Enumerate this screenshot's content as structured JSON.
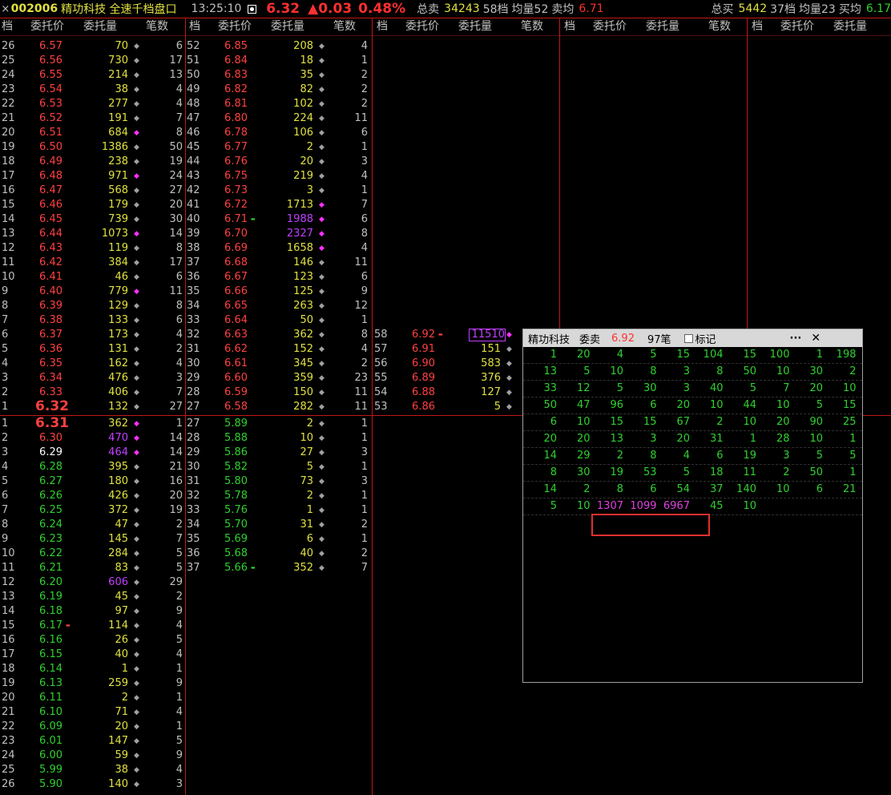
{
  "topbar": {
    "close_glyph": "×",
    "code": "002006",
    "name": "精功科技 全速千档盘口",
    "time": "13:25:10",
    "price": "6.32",
    "change": "▲0.03",
    "percent": "0.48%",
    "sell_total_label": "总卖",
    "sell_total": "34243",
    "sell_levels": "58档",
    "sell_avg_vol_label": "均量52",
    "sell_avg_price_label": "卖均",
    "sell_avg_price": "6.71",
    "buy_total_label": "总买",
    "buy_total": "5442",
    "buy_levels": "37档",
    "buy_avg_vol_label": "均量23",
    "buy_avg_price_label": "买均",
    "buy_avg_price": "6.17",
    "ratio_bar": {
      "sell_fraction": 0.87,
      "buy_fraction": 0.13,
      "sell_color": "#3a90e0",
      "buy_color": "#e0a030"
    }
  },
  "headers": {
    "level": "档",
    "price": "委托价",
    "volume": "委托量",
    "count": "笔数"
  },
  "ask_col1": [
    {
      "lvl": "26",
      "px": "6.57",
      "vol": "70",
      "cnt": "6",
      "vc": "yellow"
    },
    {
      "lvl": "25",
      "px": "6.56",
      "vol": "730",
      "cnt": "17",
      "vc": "yellow"
    },
    {
      "lvl": "24",
      "px": "6.55",
      "vol": "214",
      "cnt": "13",
      "vc": "yellow"
    },
    {
      "lvl": "23",
      "px": "6.54",
      "vol": "38",
      "cnt": "4",
      "vc": "yellow"
    },
    {
      "lvl": "22",
      "px": "6.53",
      "vol": "277",
      "cnt": "4",
      "vc": "yellow"
    },
    {
      "lvl": "21",
      "px": "6.52",
      "vol": "191",
      "cnt": "7",
      "vc": "yellow"
    },
    {
      "lvl": "20",
      "px": "6.51",
      "vol": "684",
      "cnt": "8",
      "vc": "yellow",
      "dot": "magenta"
    },
    {
      "lvl": "19",
      "px": "6.50",
      "vol": "1386",
      "cnt": "50",
      "vc": "yellow"
    },
    {
      "lvl": "18",
      "px": "6.49",
      "vol": "238",
      "cnt": "19",
      "vc": "yellow"
    },
    {
      "lvl": "17",
      "px": "6.48",
      "vol": "971",
      "cnt": "24",
      "vc": "yellow",
      "dot": "magenta"
    },
    {
      "lvl": "16",
      "px": "6.47",
      "vol": "568",
      "cnt": "27",
      "vc": "yellow"
    },
    {
      "lvl": "15",
      "px": "6.46",
      "vol": "179",
      "cnt": "20",
      "vc": "yellow"
    },
    {
      "lvl": "14",
      "px": "6.45",
      "vol": "739",
      "cnt": "30",
      "vc": "yellow"
    },
    {
      "lvl": "13",
      "px": "6.44",
      "vol": "1073",
      "cnt": "14",
      "vc": "yellow",
      "dot": "magenta"
    },
    {
      "lvl": "12",
      "px": "6.43",
      "vol": "119",
      "cnt": "8",
      "vc": "yellow"
    },
    {
      "lvl": "11",
      "px": "6.42",
      "vol": "384",
      "cnt": "17",
      "vc": "yellow"
    },
    {
      "lvl": "10",
      "px": "6.41",
      "vol": "46",
      "cnt": "6",
      "vc": "yellow"
    },
    {
      "lvl": "9",
      "px": "6.40",
      "vol": "779",
      "cnt": "11",
      "vc": "yellow",
      "dot": "magenta"
    },
    {
      "lvl": "8",
      "px": "6.39",
      "vol": "129",
      "cnt": "8",
      "vc": "yellow"
    },
    {
      "lvl": "7",
      "px": "6.38",
      "vol": "133",
      "cnt": "6",
      "vc": "yellow"
    },
    {
      "lvl": "6",
      "px": "6.37",
      "vol": "173",
      "cnt": "4",
      "vc": "yellow"
    },
    {
      "lvl": "5",
      "px": "6.36",
      "vol": "131",
      "cnt": "2",
      "vc": "yellow"
    },
    {
      "lvl": "4",
      "px": "6.35",
      "vol": "162",
      "cnt": "4",
      "vc": "yellow"
    },
    {
      "lvl": "3",
      "px": "6.34",
      "vol": "476",
      "cnt": "3",
      "vc": "yellow"
    },
    {
      "lvl": "2",
      "px": "6.33",
      "vol": "406",
      "cnt": "7",
      "vc": "yellow"
    },
    {
      "lvl": "1",
      "px": "6.32",
      "vol": "132",
      "cnt": "27",
      "vc": "yellow",
      "big": true
    }
  ],
  "ask_col2": [
    {
      "lvl": "52",
      "px": "6.85",
      "vol": "208",
      "cnt": "4",
      "vc": "yellow"
    },
    {
      "lvl": "51",
      "px": "6.84",
      "vol": "18",
      "cnt": "1",
      "vc": "yellow"
    },
    {
      "lvl": "50",
      "px": "6.83",
      "vol": "35",
      "cnt": "2",
      "vc": "yellow"
    },
    {
      "lvl": "49",
      "px": "6.82",
      "vol": "82",
      "cnt": "2",
      "vc": "yellow"
    },
    {
      "lvl": "48",
      "px": "6.81",
      "vol": "102",
      "cnt": "2",
      "vc": "yellow"
    },
    {
      "lvl": "47",
      "px": "6.80",
      "vol": "224",
      "cnt": "11",
      "vc": "yellow"
    },
    {
      "lvl": "46",
      "px": "6.78",
      "vol": "106",
      "cnt": "6",
      "vc": "yellow"
    },
    {
      "lvl": "45",
      "px": "6.77",
      "vol": "2",
      "cnt": "1",
      "vc": "yellow"
    },
    {
      "lvl": "44",
      "px": "6.76",
      "vol": "20",
      "cnt": "3",
      "vc": "yellow"
    },
    {
      "lvl": "43",
      "px": "6.75",
      "vol": "219",
      "cnt": "4",
      "vc": "yellow"
    },
    {
      "lvl": "42",
      "px": "6.73",
      "vol": "3",
      "cnt": "1",
      "vc": "yellow"
    },
    {
      "lvl": "41",
      "px": "6.72",
      "vol": "1713",
      "cnt": "7",
      "vc": "yellow",
      "dot": "magenta"
    },
    {
      "lvl": "40",
      "px": "6.71",
      "vol": "1988",
      "cnt": "6",
      "vc": "purple",
      "dot": "magenta",
      "mark": "green"
    },
    {
      "lvl": "39",
      "px": "6.70",
      "vol": "2327",
      "cnt": "8",
      "vc": "purple",
      "dot": "magenta"
    },
    {
      "lvl": "38",
      "px": "6.69",
      "vol": "1658",
      "cnt": "4",
      "vc": "yellow",
      "dot": "magenta"
    },
    {
      "lvl": "37",
      "px": "6.68",
      "vol": "146",
      "cnt": "11",
      "vc": "yellow"
    },
    {
      "lvl": "36",
      "px": "6.67",
      "vol": "123",
      "cnt": "6",
      "vc": "yellow"
    },
    {
      "lvl": "35",
      "px": "6.66",
      "vol": "125",
      "cnt": "9",
      "vc": "yellow"
    },
    {
      "lvl": "34",
      "px": "6.65",
      "vol": "263",
      "cnt": "12",
      "vc": "yellow"
    },
    {
      "lvl": "33",
      "px": "6.64",
      "vol": "50",
      "cnt": "1",
      "vc": "yellow"
    },
    {
      "lvl": "32",
      "px": "6.63",
      "vol": "362",
      "cnt": "8",
      "vc": "yellow"
    },
    {
      "lvl": "31",
      "px": "6.62",
      "vol": "152",
      "cnt": "4",
      "vc": "yellow"
    },
    {
      "lvl": "30",
      "px": "6.61",
      "vol": "345",
      "cnt": "2",
      "vc": "yellow"
    },
    {
      "lvl": "29",
      "px": "6.60",
      "vol": "359",
      "cnt": "23",
      "vc": "yellow"
    },
    {
      "lvl": "28",
      "px": "6.59",
      "vol": "150",
      "cnt": "11",
      "vc": "yellow"
    },
    {
      "lvl": "27",
      "px": "6.58",
      "vol": "282",
      "cnt": "11",
      "vc": "yellow"
    }
  ],
  "ask_col3": [
    {
      "lvl": "58",
      "px": "6.92",
      "vol": "11510",
      "cnt": "",
      "vc": "purple",
      "dot": "magenta",
      "mark": "red",
      "boxed": true
    },
    {
      "lvl": "57",
      "px": "6.91",
      "vol": "151",
      "cnt": "",
      "vc": "yellow"
    },
    {
      "lvl": "56",
      "px": "6.90",
      "vol": "583",
      "cnt": "",
      "vc": "yellow"
    },
    {
      "lvl": "55",
      "px": "6.89",
      "vol": "376",
      "cnt": "",
      "vc": "yellow"
    },
    {
      "lvl": "54",
      "px": "6.88",
      "vol": "127",
      "cnt": "",
      "vc": "yellow"
    },
    {
      "lvl": "53",
      "px": "6.86",
      "vol": "5",
      "cnt": "",
      "vc": "yellow"
    }
  ],
  "bid_col1": [
    {
      "lvl": "1",
      "px": "6.31",
      "vol": "362",
      "cnt": "1",
      "pc": "red",
      "vc": "yellow",
      "dot": "magenta",
      "big": true
    },
    {
      "lvl": "2",
      "px": "6.30",
      "vol": "470",
      "cnt": "14",
      "pc": "red",
      "vc": "purple",
      "dot": "magenta"
    },
    {
      "lvl": "3",
      "px": "6.29",
      "vol": "464",
      "cnt": "14",
      "pc": "white",
      "vc": "purple",
      "dot": "magenta"
    },
    {
      "lvl": "4",
      "px": "6.28",
      "vol": "395",
      "cnt": "21",
      "pc": "green",
      "vc": "yellow"
    },
    {
      "lvl": "5",
      "px": "6.27",
      "vol": "180",
      "cnt": "16",
      "pc": "green",
      "vc": "yellow"
    },
    {
      "lvl": "6",
      "px": "6.26",
      "vol": "426",
      "cnt": "20",
      "pc": "green",
      "vc": "yellow"
    },
    {
      "lvl": "7",
      "px": "6.25",
      "vol": "372",
      "cnt": "19",
      "pc": "green",
      "vc": "yellow"
    },
    {
      "lvl": "8",
      "px": "6.24",
      "vol": "47",
      "cnt": "2",
      "pc": "green",
      "vc": "yellow"
    },
    {
      "lvl": "9",
      "px": "6.23",
      "vol": "145",
      "cnt": "7",
      "pc": "green",
      "vc": "yellow"
    },
    {
      "lvl": "10",
      "px": "6.22",
      "vol": "284",
      "cnt": "5",
      "pc": "green",
      "vc": "yellow"
    },
    {
      "lvl": "11",
      "px": "6.21",
      "vol": "83",
      "cnt": "5",
      "pc": "green",
      "vc": "yellow"
    },
    {
      "lvl": "12",
      "px": "6.20",
      "vol": "606",
      "cnt": "29",
      "pc": "green",
      "vc": "purple"
    },
    {
      "lvl": "13",
      "px": "6.19",
      "vol": "45",
      "cnt": "2",
      "pc": "green",
      "vc": "yellow"
    },
    {
      "lvl": "14",
      "px": "6.18",
      "vol": "97",
      "cnt": "9",
      "pc": "green",
      "vc": "yellow"
    },
    {
      "lvl": "15",
      "px": "6.17",
      "vol": "114",
      "cnt": "4",
      "pc": "green",
      "vc": "yellow",
      "mark": "red"
    },
    {
      "lvl": "16",
      "px": "6.16",
      "vol": "26",
      "cnt": "5",
      "pc": "green",
      "vc": "yellow"
    },
    {
      "lvl": "17",
      "px": "6.15",
      "vol": "40",
      "cnt": "4",
      "pc": "green",
      "vc": "yellow"
    },
    {
      "lvl": "18",
      "px": "6.14",
      "vol": "1",
      "cnt": "1",
      "pc": "green",
      "vc": "yellow"
    },
    {
      "lvl": "19",
      "px": "6.13",
      "vol": "259",
      "cnt": "9",
      "pc": "green",
      "vc": "yellow"
    },
    {
      "lvl": "20",
      "px": "6.11",
      "vol": "2",
      "cnt": "1",
      "pc": "green",
      "vc": "yellow"
    },
    {
      "lvl": "21",
      "px": "6.10",
      "vol": "71",
      "cnt": "4",
      "pc": "green",
      "vc": "yellow"
    },
    {
      "lvl": "22",
      "px": "6.09",
      "vol": "20",
      "cnt": "1",
      "pc": "green",
      "vc": "yellow"
    },
    {
      "lvl": "23",
      "px": "6.01",
      "vol": "147",
      "cnt": "5",
      "pc": "green",
      "vc": "yellow"
    },
    {
      "lvl": "24",
      "px": "6.00",
      "vol": "59",
      "cnt": "9",
      "pc": "green",
      "vc": "yellow"
    },
    {
      "lvl": "25",
      "px": "5.99",
      "vol": "38",
      "cnt": "4",
      "pc": "green",
      "vc": "yellow"
    },
    {
      "lvl": "26",
      "px": "5.90",
      "vol": "140",
      "cnt": "3",
      "pc": "green",
      "vc": "yellow"
    }
  ],
  "bid_col2": [
    {
      "lvl": "27",
      "px": "5.89",
      "vol": "2",
      "cnt": "1",
      "pc": "green",
      "vc": "yellow"
    },
    {
      "lvl": "28",
      "px": "5.88",
      "vol": "10",
      "cnt": "1",
      "pc": "green",
      "vc": "yellow"
    },
    {
      "lvl": "29",
      "px": "5.86",
      "vol": "27",
      "cnt": "3",
      "pc": "green",
      "vc": "yellow"
    },
    {
      "lvl": "30",
      "px": "5.82",
      "vol": "5",
      "cnt": "1",
      "pc": "green",
      "vc": "yellow"
    },
    {
      "lvl": "31",
      "px": "5.80",
      "vol": "73",
      "cnt": "3",
      "pc": "green",
      "vc": "yellow"
    },
    {
      "lvl": "32",
      "px": "5.78",
      "vol": "2",
      "cnt": "1",
      "pc": "green",
      "vc": "yellow"
    },
    {
      "lvl": "33",
      "px": "5.76",
      "vol": "1",
      "cnt": "1",
      "pc": "green",
      "vc": "yellow"
    },
    {
      "lvl": "34",
      "px": "5.70",
      "vol": "31",
      "cnt": "2",
      "pc": "green",
      "vc": "yellow"
    },
    {
      "lvl": "35",
      "px": "5.69",
      "vol": "6",
      "cnt": "1",
      "pc": "green",
      "vc": "yellow"
    },
    {
      "lvl": "36",
      "px": "5.68",
      "vol": "40",
      "cnt": "2",
      "pc": "green",
      "vc": "yellow"
    },
    {
      "lvl": "37",
      "px": "5.66",
      "vol": "352",
      "cnt": "7",
      "pc": "green",
      "vc": "yellow",
      "mark": "green"
    }
  ],
  "popup": {
    "title": "精功科技",
    "side": "委卖",
    "price": "6.92",
    "count": "97笔",
    "mark_label": "标记",
    "more": "···",
    "close": "✕",
    "rows": [
      [
        "1",
        "20",
        "4",
        "5",
        "15",
        "104",
        "15",
        "100",
        "1",
        "198"
      ],
      [
        "13",
        "5",
        "10",
        "8",
        "3",
        "8",
        "50",
        "10",
        "30",
        "2"
      ],
      [
        "33",
        "12",
        "5",
        "30",
        "3",
        "40",
        "5",
        "7",
        "20",
        "10"
      ],
      [
        "50",
        "47",
        "96",
        "6",
        "20",
        "10",
        "44",
        "10",
        "5",
        "15"
      ],
      [
        "6",
        "10",
        "15",
        "15",
        "67",
        "2",
        "10",
        "20",
        "90",
        "25"
      ],
      [
        "20",
        "20",
        "13",
        "3",
        "20",
        "31",
        "1",
        "28",
        "10",
        "1"
      ],
      [
        "14",
        "29",
        "2",
        "8",
        "4",
        "6",
        "19",
        "3",
        "5",
        "5"
      ],
      [
        "8",
        "30",
        "19",
        "53",
        "5",
        "18",
        "11",
        "2",
        "50",
        "1"
      ],
      [
        "14",
        "2",
        "8",
        "6",
        "54",
        "37",
        "140",
        "10",
        "6",
        "21"
      ],
      [
        "5",
        "10",
        "1307",
        "1099",
        "6967",
        "45",
        "10",
        "",
        "",
        ""
      ]
    ],
    "highlight_values": [
      "1307",
      "1099",
      "6967"
    ]
  }
}
